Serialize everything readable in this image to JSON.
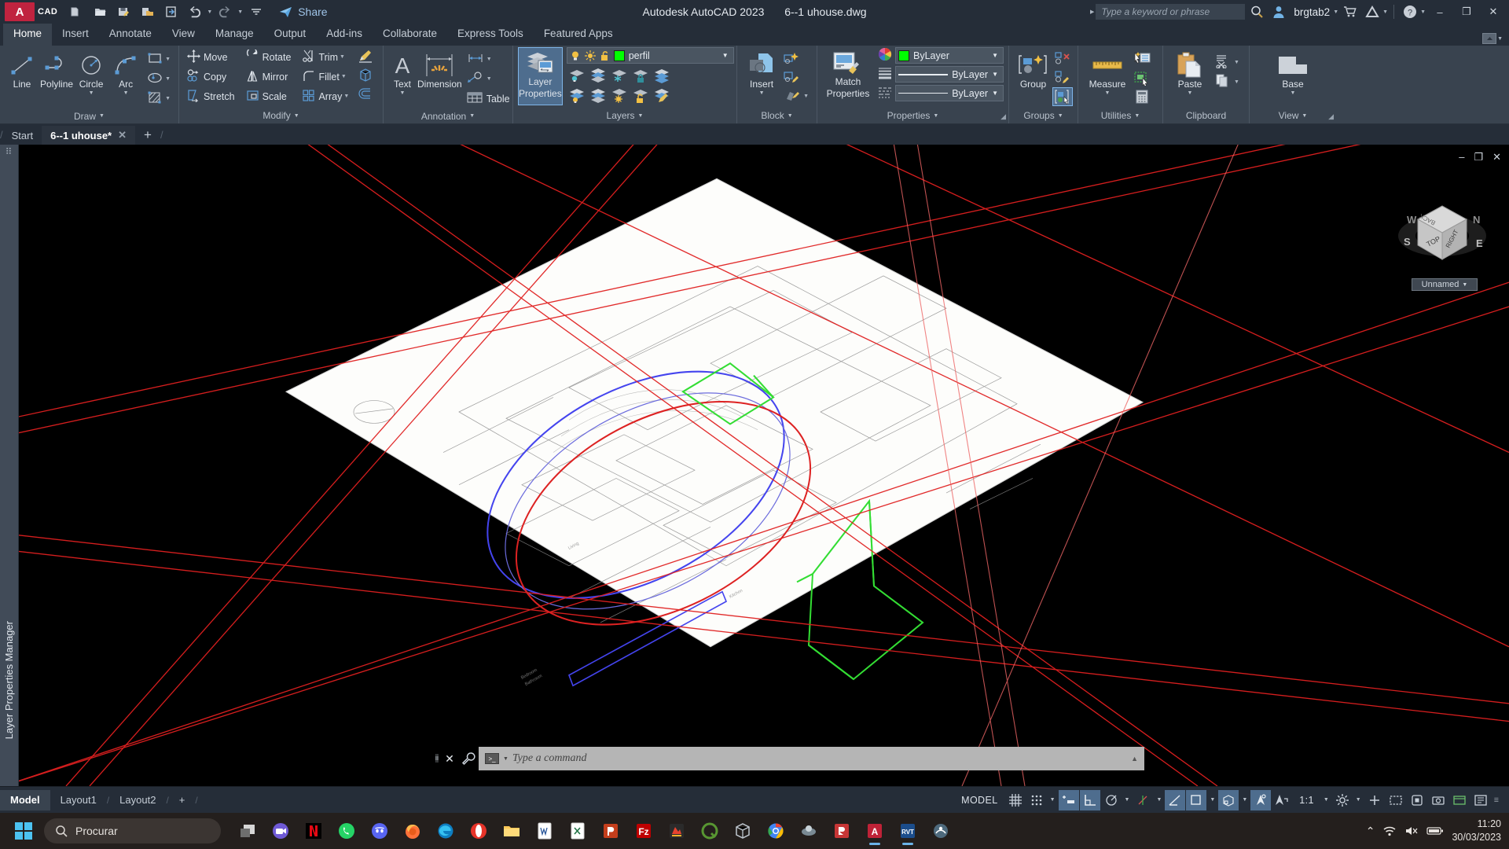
{
  "titlebar": {
    "logo": "A",
    "cad_badge": "CAD",
    "quick_access": [
      {
        "name": "new-icon",
        "label": "New"
      },
      {
        "name": "open-icon",
        "label": "Open"
      },
      {
        "name": "save-icon",
        "label": "Save"
      },
      {
        "name": "save-as-icon",
        "label": "Save As"
      },
      {
        "name": "plot-icon",
        "label": "Plot"
      },
      {
        "name": "undo-icon",
        "label": "Undo"
      },
      {
        "name": "redo-icon",
        "label": "Redo"
      },
      {
        "name": "qat-more-icon",
        "label": "Customize Quick Access Toolbar"
      }
    ],
    "share_label": "Share",
    "app_title": "Autodesk AutoCAD 2023",
    "file_title": "6--1 uhouse.dwg",
    "search_placeholder": "Type a keyword or phrase",
    "username": "brgtab2",
    "window_buttons": {
      "minimize": "–",
      "maximize": "❐",
      "close": "✕"
    }
  },
  "ribbon": {
    "tabs": [
      {
        "label": "Home",
        "active": true
      },
      {
        "label": "Insert",
        "active": false
      },
      {
        "label": "Annotate",
        "active": false
      },
      {
        "label": "View",
        "active": false
      },
      {
        "label": "Manage",
        "active": false
      },
      {
        "label": "Output",
        "active": false
      },
      {
        "label": "Add-ins",
        "active": false
      },
      {
        "label": "Collaborate",
        "active": false
      },
      {
        "label": "Express Tools",
        "active": false
      },
      {
        "label": "Featured Apps",
        "active": false
      }
    ],
    "panels": {
      "draw": {
        "title": "Draw",
        "big": [
          {
            "label": "Line",
            "icon": "line-icon",
            "dropdown": false
          },
          {
            "label": "Polyline",
            "icon": "polyline-icon",
            "dropdown": false
          },
          {
            "label": "Circle",
            "icon": "circle-icon",
            "dropdown": true
          },
          {
            "label": "Arc",
            "icon": "arc-icon",
            "dropdown": true
          }
        ],
        "small": [
          {
            "icon": "rectangle-icon",
            "label": "Rectangle"
          },
          {
            "icon": "ellipse-icon",
            "label": "Ellipse"
          },
          {
            "icon": "hatch-icon",
            "label": "Hatch"
          }
        ]
      },
      "modify": {
        "title": "Modify",
        "rows": [
          [
            {
              "label": "Move",
              "icon": "move-icon"
            },
            {
              "label": "Rotate",
              "icon": "rotate-icon"
            },
            {
              "label": "Trim",
              "icon": "trim-icon",
              "dropdown": true
            }
          ],
          [
            {
              "label": "Copy",
              "icon": "copy-icon"
            },
            {
              "label": "Mirror",
              "icon": "mirror-icon"
            },
            {
              "label": "Fillet",
              "icon": "fillet-icon",
              "dropdown": true
            }
          ],
          [
            {
              "label": "Stretch",
              "icon": "stretch-icon"
            },
            {
              "label": "Scale",
              "icon": "scale-icon"
            },
            {
              "label": "Array",
              "icon": "array-icon",
              "dropdown": true
            }
          ]
        ],
        "extra": [
          {
            "icon": "erase-icon",
            "label": "Erase"
          },
          {
            "icon": "explode-icon",
            "label": "Explode"
          },
          {
            "icon": "offset-icon",
            "label": "Offset"
          }
        ]
      },
      "annotation": {
        "title": "Annotation",
        "big": [
          {
            "label": "Text",
            "icon": "text-icon",
            "dropdown": true
          },
          {
            "label": "Dimension",
            "icon": "dimension-icon",
            "dropdown": false
          }
        ],
        "small": [
          {
            "icon": "linear-dimension-icon",
            "label": "Linear",
            "dropdown": true
          },
          {
            "icon": "leader-icon",
            "label": "Leader",
            "dropdown": true
          },
          {
            "icon": "table-icon",
            "label": "Table",
            "dropdown": false
          }
        ]
      },
      "layers": {
        "title": "Layers",
        "big": {
          "label": "Layer\nProperties",
          "line1": "Layer",
          "line2": "Properties",
          "icon": "layer-properties-icon",
          "selected": true
        },
        "current_layer": "perfil",
        "layer_color": "#00ff00",
        "layer_state_icons": [
          "lightbulb-on-icon",
          "sun-icon",
          "unlock-icon"
        ],
        "tool_icons_row1": [
          "layer-off-icon",
          "isolate-icon",
          "freeze-icon",
          "layer-lock-icon",
          "layer-merge-icon"
        ],
        "tool_icons_row2": [
          "layer-on-icon",
          "unisolate-icon",
          "thaw-icon",
          "layer-unlock-icon",
          "layer-match-icon"
        ]
      },
      "block": {
        "title": "Block",
        "big": {
          "label": "Insert",
          "icon": "insert-block-icon",
          "dropdown": true
        },
        "small": [
          {
            "icon": "create-block-icon",
            "label": "Create Block"
          },
          {
            "icon": "edit-block-icon",
            "label": "Edit Block"
          },
          {
            "icon": "edit-attribute-icon",
            "label": "Edit Attribute",
            "dropdown": true
          }
        ]
      },
      "properties": {
        "title": "Properties",
        "big": {
          "label": "Match\nProperties",
          "line1": "Match",
          "line2": "Properties",
          "icon": "match-properties-icon"
        },
        "color": {
          "icon": "color-wheel-icon",
          "value": "ByLayer",
          "swatch": "#00ff00"
        },
        "linewidth": {
          "icon": "lineweight-icon",
          "value": "ByLayer"
        },
        "linetype": {
          "icon": "linetype-icon",
          "value": "ByLayer"
        }
      },
      "groups": {
        "title": "Groups",
        "big": {
          "label": "Group",
          "icon": "group-icon"
        },
        "small": [
          {
            "icon": "ungroup-icon",
            "label": "Ungroup"
          },
          {
            "icon": "group-edit-icon",
            "label": "Group Edit"
          },
          {
            "icon": "group-selection-on-icon",
            "label": "Group Selection On/Off",
            "selected": true
          }
        ]
      },
      "utilities": {
        "title": "Utilities",
        "big": {
          "label": "Measure",
          "icon": "measure-icon",
          "dropdown": true
        },
        "small": [
          {
            "icon": "quick-select-icon",
            "label": "Quick Select"
          },
          {
            "icon": "select-all-icon",
            "label": "Select All"
          },
          {
            "icon": "calculator-icon",
            "label": "Quick Calculator"
          }
        ]
      },
      "clipboard": {
        "title": "Clipboard",
        "big": {
          "label": "Paste",
          "icon": "paste-icon",
          "dropdown": true
        },
        "small": [
          {
            "icon": "cut-icon",
            "label": "Cut",
            "dropdown": true
          },
          {
            "icon": "copy-clip-icon",
            "label": "Copy",
            "dropdown": true
          }
        ]
      },
      "view": {
        "title": "View",
        "big": {
          "label": "Base",
          "icon": "base-view-icon",
          "dropdown": true
        }
      }
    }
  },
  "doctabs": {
    "tabs": [
      {
        "label": "Start",
        "active": false,
        "closable": false
      },
      {
        "label": "6--1 uhouse*",
        "active": true,
        "closable": true
      }
    ],
    "add_label": "+"
  },
  "left_panel": {
    "title": "Layer Properties Manager"
  },
  "viewport": {
    "controls": {
      "minimize": "–",
      "restore": "❐",
      "close": "✕"
    },
    "viewcube": {
      "top": "TOP",
      "right": "RIGHT",
      "back": "BACK",
      "compass": {
        "n": "N",
        "s": "S",
        "e": "E",
        "w": "W"
      }
    },
    "view_name": "Unnamed",
    "drawing_labels": [
      "Kitchen",
      "Bedroom",
      "Bathroom",
      "Living"
    ]
  },
  "commandline": {
    "placeholder": "Type a command",
    "close_label": "✕",
    "expand_label": "▲"
  },
  "statusbar": {
    "layout_tabs": [
      {
        "label": "Model",
        "active": true
      },
      {
        "label": "Layout1",
        "active": false
      },
      {
        "label": "Layout2",
        "active": false
      }
    ],
    "add_layout": "+",
    "space_label": "MODEL",
    "scale": "1:1",
    "toggles": [
      {
        "name": "grid-display-icon",
        "on": false
      },
      {
        "name": "snap-mode-icon",
        "on": false
      },
      {
        "name": "infer-constraints-icon",
        "on": true
      },
      {
        "name": "ortho-mode-icon",
        "on": true
      },
      {
        "name": "polar-tracking-icon",
        "on": false
      },
      {
        "name": "object-snap-tracking-icon",
        "on": false
      },
      {
        "name": "object-snap-icon",
        "on": true
      },
      {
        "name": "lineweight-display-icon",
        "on": true
      },
      {
        "name": "3d-object-snap-icon",
        "on": true
      },
      {
        "name": "dynamic-ucs-icon",
        "on": true
      },
      {
        "name": "selection-cycling-icon",
        "on": false
      },
      {
        "name": "annotation-visibility-icon",
        "on": false
      },
      {
        "name": "autoscale-icon",
        "on": false
      },
      {
        "name": "workspace-switching-icon",
        "on": false
      },
      {
        "name": "annotation-monitor-icon",
        "on": false
      },
      {
        "name": "isolate-objects-icon",
        "on": false
      },
      {
        "name": "hardware-acceleration-icon",
        "on": false
      },
      {
        "name": "clean-screen-icon",
        "on": false
      },
      {
        "name": "customization-icon",
        "on": false
      }
    ]
  },
  "taskbar": {
    "search_placeholder": "Procurar",
    "apps": [
      {
        "name": "task-view-icon",
        "label": "Task View"
      },
      {
        "name": "teams-icon",
        "label": "Microsoft Teams"
      },
      {
        "name": "netflix-icon",
        "label": "Netflix"
      },
      {
        "name": "whatsapp-icon",
        "label": "WhatsApp"
      },
      {
        "name": "discord-icon",
        "label": "Discord"
      },
      {
        "name": "firefox-icon",
        "label": "Firefox"
      },
      {
        "name": "edge-icon",
        "label": "Microsoft Edge"
      },
      {
        "name": "opera-icon",
        "label": "Opera"
      },
      {
        "name": "file-explorer-icon",
        "label": "File Explorer"
      },
      {
        "name": "word-icon",
        "label": "Word"
      },
      {
        "name": "excel-icon",
        "label": "Excel"
      },
      {
        "name": "powerpoint-icon",
        "label": "PowerPoint"
      },
      {
        "name": "filezilla-icon",
        "label": "FileZilla"
      },
      {
        "name": "sketchup-icon",
        "label": "SketchUp"
      },
      {
        "name": "qgis-icon",
        "label": "QGIS"
      },
      {
        "name": "3d-viewer-icon",
        "label": "3D Viewer"
      },
      {
        "name": "chrome-icon",
        "label": "Chrome"
      },
      {
        "name": "lumion-icon",
        "label": "Lumion"
      },
      {
        "name": "revit-red-icon",
        "label": "Revit"
      },
      {
        "name": "autocad-icon",
        "label": "AutoCAD",
        "active": true
      },
      {
        "name": "revit-icon",
        "label": "Revit",
        "active": true
      },
      {
        "name": "navisworks-icon",
        "label": "Navisworks"
      }
    ],
    "tray": {
      "chevron": "⌃",
      "wifi": "wifi-icon",
      "volume": "volume-icon",
      "battery": "battery-icon",
      "time": "11:20",
      "date": "30/03/2023"
    }
  }
}
